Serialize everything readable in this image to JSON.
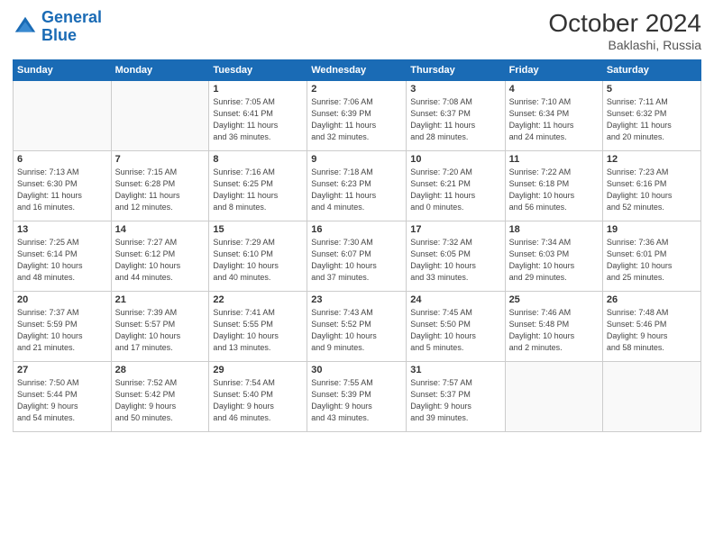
{
  "logo": {
    "line1": "General",
    "line2": "Blue"
  },
  "title": "October 2024",
  "subtitle": "Baklashi, Russia",
  "days_header": [
    "Sunday",
    "Monday",
    "Tuesday",
    "Wednesday",
    "Thursday",
    "Friday",
    "Saturday"
  ],
  "weeks": [
    [
      {
        "day": "",
        "detail": ""
      },
      {
        "day": "",
        "detail": ""
      },
      {
        "day": "1",
        "detail": "Sunrise: 7:05 AM\nSunset: 6:41 PM\nDaylight: 11 hours\nand 36 minutes."
      },
      {
        "day": "2",
        "detail": "Sunrise: 7:06 AM\nSunset: 6:39 PM\nDaylight: 11 hours\nand 32 minutes."
      },
      {
        "day": "3",
        "detail": "Sunrise: 7:08 AM\nSunset: 6:37 PM\nDaylight: 11 hours\nand 28 minutes."
      },
      {
        "day": "4",
        "detail": "Sunrise: 7:10 AM\nSunset: 6:34 PM\nDaylight: 11 hours\nand 24 minutes."
      },
      {
        "day": "5",
        "detail": "Sunrise: 7:11 AM\nSunset: 6:32 PM\nDaylight: 11 hours\nand 20 minutes."
      }
    ],
    [
      {
        "day": "6",
        "detail": "Sunrise: 7:13 AM\nSunset: 6:30 PM\nDaylight: 11 hours\nand 16 minutes."
      },
      {
        "day": "7",
        "detail": "Sunrise: 7:15 AM\nSunset: 6:28 PM\nDaylight: 11 hours\nand 12 minutes."
      },
      {
        "day": "8",
        "detail": "Sunrise: 7:16 AM\nSunset: 6:25 PM\nDaylight: 11 hours\nand 8 minutes."
      },
      {
        "day": "9",
        "detail": "Sunrise: 7:18 AM\nSunset: 6:23 PM\nDaylight: 11 hours\nand 4 minutes."
      },
      {
        "day": "10",
        "detail": "Sunrise: 7:20 AM\nSunset: 6:21 PM\nDaylight: 11 hours\nand 0 minutes."
      },
      {
        "day": "11",
        "detail": "Sunrise: 7:22 AM\nSunset: 6:18 PM\nDaylight: 10 hours\nand 56 minutes."
      },
      {
        "day": "12",
        "detail": "Sunrise: 7:23 AM\nSunset: 6:16 PM\nDaylight: 10 hours\nand 52 minutes."
      }
    ],
    [
      {
        "day": "13",
        "detail": "Sunrise: 7:25 AM\nSunset: 6:14 PM\nDaylight: 10 hours\nand 48 minutes."
      },
      {
        "day": "14",
        "detail": "Sunrise: 7:27 AM\nSunset: 6:12 PM\nDaylight: 10 hours\nand 44 minutes."
      },
      {
        "day": "15",
        "detail": "Sunrise: 7:29 AM\nSunset: 6:10 PM\nDaylight: 10 hours\nand 40 minutes."
      },
      {
        "day": "16",
        "detail": "Sunrise: 7:30 AM\nSunset: 6:07 PM\nDaylight: 10 hours\nand 37 minutes."
      },
      {
        "day": "17",
        "detail": "Sunrise: 7:32 AM\nSunset: 6:05 PM\nDaylight: 10 hours\nand 33 minutes."
      },
      {
        "day": "18",
        "detail": "Sunrise: 7:34 AM\nSunset: 6:03 PM\nDaylight: 10 hours\nand 29 minutes."
      },
      {
        "day": "19",
        "detail": "Sunrise: 7:36 AM\nSunset: 6:01 PM\nDaylight: 10 hours\nand 25 minutes."
      }
    ],
    [
      {
        "day": "20",
        "detail": "Sunrise: 7:37 AM\nSunset: 5:59 PM\nDaylight: 10 hours\nand 21 minutes."
      },
      {
        "day": "21",
        "detail": "Sunrise: 7:39 AM\nSunset: 5:57 PM\nDaylight: 10 hours\nand 17 minutes."
      },
      {
        "day": "22",
        "detail": "Sunrise: 7:41 AM\nSunset: 5:55 PM\nDaylight: 10 hours\nand 13 minutes."
      },
      {
        "day": "23",
        "detail": "Sunrise: 7:43 AM\nSunset: 5:52 PM\nDaylight: 10 hours\nand 9 minutes."
      },
      {
        "day": "24",
        "detail": "Sunrise: 7:45 AM\nSunset: 5:50 PM\nDaylight: 10 hours\nand 5 minutes."
      },
      {
        "day": "25",
        "detail": "Sunrise: 7:46 AM\nSunset: 5:48 PM\nDaylight: 10 hours\nand 2 minutes."
      },
      {
        "day": "26",
        "detail": "Sunrise: 7:48 AM\nSunset: 5:46 PM\nDaylight: 9 hours\nand 58 minutes."
      }
    ],
    [
      {
        "day": "27",
        "detail": "Sunrise: 7:50 AM\nSunset: 5:44 PM\nDaylight: 9 hours\nand 54 minutes."
      },
      {
        "day": "28",
        "detail": "Sunrise: 7:52 AM\nSunset: 5:42 PM\nDaylight: 9 hours\nand 50 minutes."
      },
      {
        "day": "29",
        "detail": "Sunrise: 7:54 AM\nSunset: 5:40 PM\nDaylight: 9 hours\nand 46 minutes."
      },
      {
        "day": "30",
        "detail": "Sunrise: 7:55 AM\nSunset: 5:39 PM\nDaylight: 9 hours\nand 43 minutes."
      },
      {
        "day": "31",
        "detail": "Sunrise: 7:57 AM\nSunset: 5:37 PM\nDaylight: 9 hours\nand 39 minutes."
      },
      {
        "day": "",
        "detail": ""
      },
      {
        "day": "",
        "detail": ""
      }
    ]
  ]
}
